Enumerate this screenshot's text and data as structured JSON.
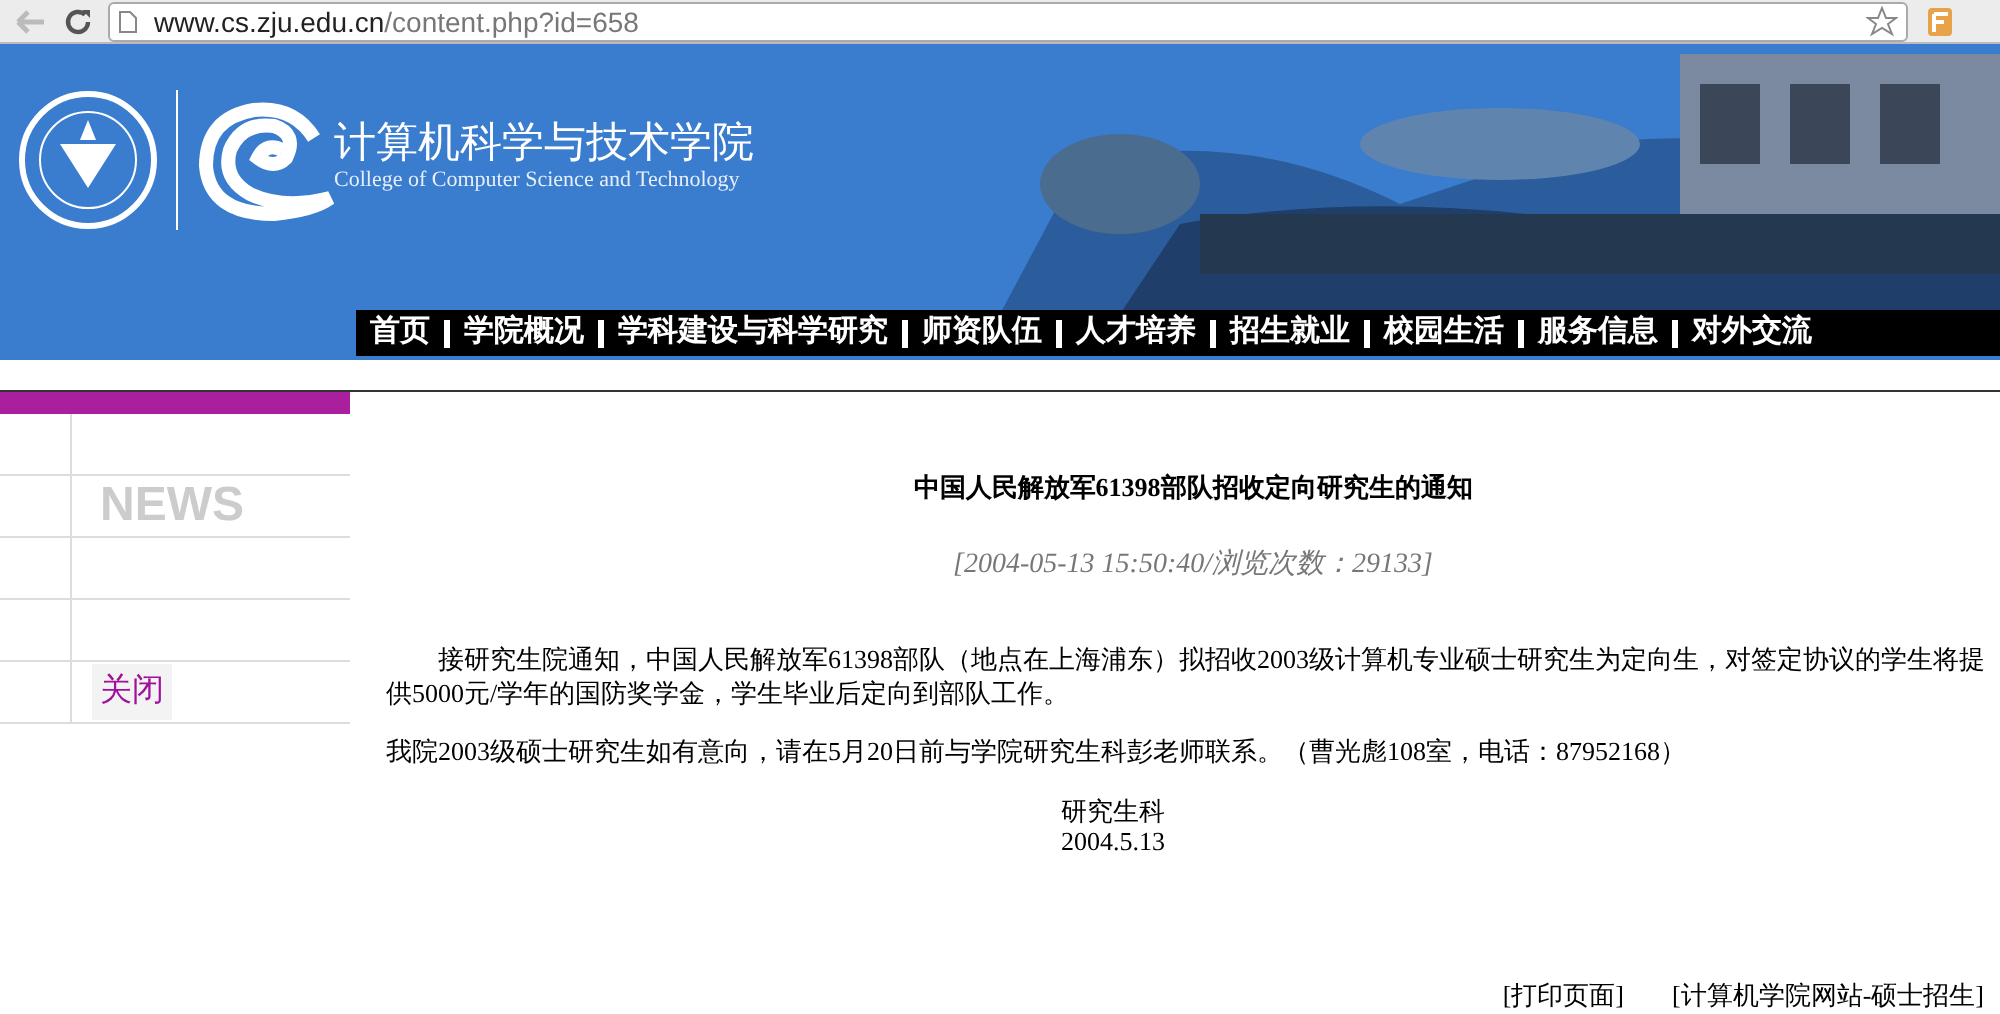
{
  "browser": {
    "url_host": "www.cs.zju.edu.cn",
    "url_path": "/content.php?id=658"
  },
  "header": {
    "title": "计算机科学与技术学院",
    "subtitle": "College of Computer Science and Technology",
    "nav": [
      "首页",
      "学院概况",
      "学科建设与科学研究",
      "师资队伍",
      "人才培养",
      "招生就业",
      "校园生活",
      "服务信息",
      "对外交流"
    ]
  },
  "sidebar": {
    "heading": "NEWS",
    "close_link": "关闭"
  },
  "article": {
    "title": "中国人民解放军61398部队招收定向研究生的通知",
    "meta": "[2004-05-13 15:50:40/浏览次数：29133]",
    "paragraphs": [
      "接研究生院通知，中国人民解放军61398部队（地点在上海浦东）拟招收2003级计算机专业硕士研究生为定向生，对签定协议的学生将提供5000元/学年的国防奖学金，学生毕业后定向到部队工作。",
      "我院2003级硕士研究生如有意向，请在5月20日前与学院研究生科彭老师联系。（曹光彪108室，电话：87952168）"
    ],
    "signature": [
      "研究生科",
      "2004.5.13"
    ]
  },
  "footer_links": [
    "[打印页面]",
    "[计算机学院网站-硕士招生]"
  ]
}
